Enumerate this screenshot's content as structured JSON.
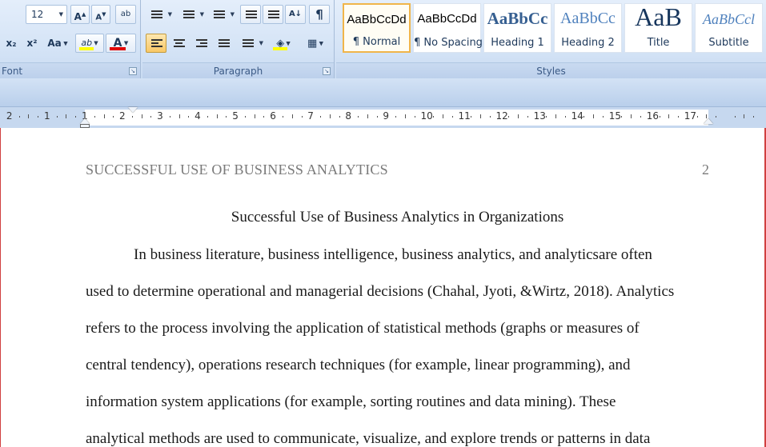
{
  "ribbon": {
    "font_group": {
      "label": "Font",
      "size_value": "12",
      "grow_label": "A",
      "shrink_label": "A",
      "clear_label": "ab",
      "subscript_label": "x₂",
      "superscript_label": "x²",
      "change_case_label": "Aa",
      "highlight_label": "ab",
      "font_color_label": "A",
      "highlight_color": "#ffff00",
      "font_color": "#e00000"
    },
    "paragraph_group": {
      "label": "Paragraph",
      "pilcrow_label": "¶",
      "sort_label": "A↓"
    },
    "styles_group": {
      "label": "Styles",
      "items": [
        {
          "sample": "AaBbCcDd",
          "name": "¶ Normal",
          "selected": true
        },
        {
          "sample": "AaBbCcDd",
          "name": "¶ No Spacing"
        },
        {
          "sample": "AaBbCc",
          "name": "Heading 1"
        },
        {
          "sample": "AaBbCc",
          "name": "Heading 2"
        },
        {
          "sample": "AaB",
          "name": "Title"
        },
        {
          "sample": "AaBbCcl",
          "name": "Subtitle"
        }
      ]
    }
  },
  "ruler": {
    "numbers": [
      "2",
      "1",
      "1",
      "2",
      "3",
      "4",
      "5",
      "6",
      "7",
      "8",
      "9",
      "10",
      "11",
      "12",
      "13",
      "14",
      "15",
      "16",
      "17"
    ]
  },
  "document": {
    "header_text": "SUCCESSFUL USE OF BUSINESS ANALYTICS",
    "page_number": "2",
    "title": "Successful Use of Business Analytics in Organizations",
    "lines": [
      "In business literature, business intelligence, business analytics, and analyticsare often",
      "used to determine operational and managerial decisions (Chahal, Jyoti, &Wirtz, 2018). Analytics",
      "refers to the process involving the application of statistical methods (graphs or measures of",
      "central tendency), operations research techniques (for example, linear programming), and",
      "information system applications (for example, sorting routines and data mining).  These",
      "analytical methods are used to communicate, visualize, and explore trends or patterns in data"
    ]
  }
}
